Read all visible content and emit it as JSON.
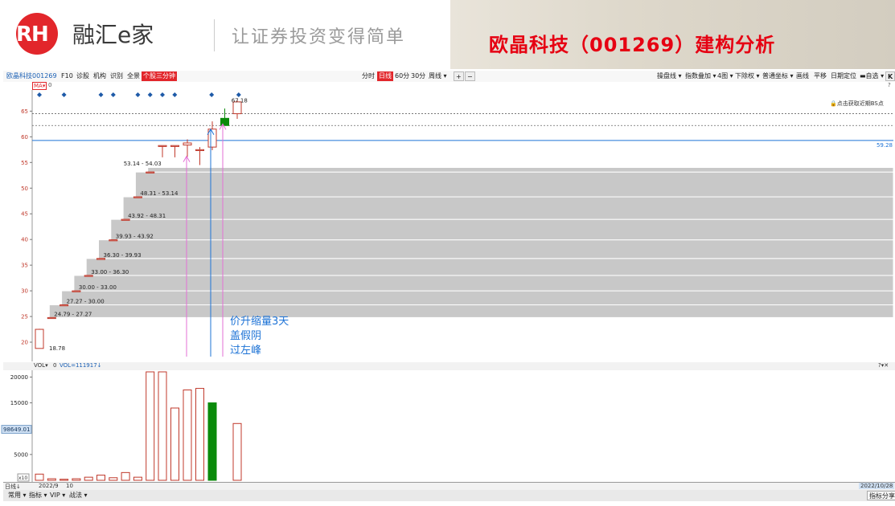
{
  "header": {
    "logo_mark": "RH",
    "logo_name": "融汇e家",
    "slogan": "让证券投资变得简单",
    "title": "欧晶科技（001269）建构分析"
  },
  "toolbar": {
    "stock_name": "欧晶科技",
    "stock_code": "001269",
    "left_items": [
      "F10",
      "诊股",
      "机构",
      "识别",
      "全景"
    ],
    "active_item": "个股三分钟",
    "period_items": [
      "分时",
      "日线",
      "60分",
      "30分",
      "周线 ▾"
    ],
    "active_period": "日线",
    "zoom_in": "+",
    "zoom_out": "−",
    "right_items": [
      "操盘线 ▾",
      "指数叠加 ▾",
      "4图 ▾",
      "下除权 ▾",
      "普通坐标 ▾",
      "画线",
      "平移",
      "日期定位",
      "▬自选 ▾"
    ],
    "help": "?"
  },
  "indicator": {
    "ma_label": "MA▾",
    "ma_value": "0"
  },
  "bs_hint": "点击获取近期BS点",
  "price_line_label": "59.28",
  "price_axis": [
    "65",
    "60",
    "55",
    "50",
    "45",
    "40",
    "35",
    "30",
    "25",
    "20"
  ],
  "step_labels": [
    "24.79 - 27.27",
    "27.27 - 30.00",
    "30.00 - 33.00",
    "33.00 - 36.30",
    "36.30 - 39.93",
    "39.93 - 43.92",
    "43.92 - 48.31",
    "48.31 - 53.14",
    "53.14 - 54.03"
  ],
  "low_label": "18.78",
  "high_label": "67.18",
  "annotation": [
    "价升缩量3天",
    "盖假阴",
    "过左峰"
  ],
  "volume": {
    "head_label": "VOL▾",
    "head_value": "0",
    "head_detail": "VOL=111917↓",
    "axis": [
      "20000",
      "15000",
      "5000"
    ],
    "current_readout": "98649.01",
    "unit": "x10"
  },
  "axis": {
    "left": "日线↓",
    "date1": "2022/9",
    "date2": "10",
    "date_right": "2022/10/28"
  },
  "bottom": {
    "items": [
      "常用 ▾",
      "指标 ▾",
      "VIP ▾",
      "战法 ▾"
    ],
    "share": "指标分享"
  },
  "colors": {
    "accent_red": "#e60012",
    "up": "#c0392b",
    "down": "#0a8a0a",
    "step_fill": "#c8c8c8",
    "price_line": "#1e73d6",
    "arrow_pink": "#e36fd6",
    "arrow_blue": "#1e73d6"
  },
  "chart_data": {
    "type": "candlestick",
    "ylim": [
      17.5,
      68.5
    ],
    "candles": [
      {
        "open": 18.78,
        "close": 22.5,
        "high": 22.6,
        "low": 18.78,
        "dir": "up"
      },
      {
        "open": 24.79,
        "close": 24.79,
        "high": 24.79,
        "low": 24.79,
        "dir": "up"
      },
      {
        "open": 27.27,
        "close": 27.27,
        "high": 27.27,
        "low": 27.27,
        "dir": "up"
      },
      {
        "open": 30.0,
        "close": 30.0,
        "high": 30.0,
        "low": 30.0,
        "dir": "up"
      },
      {
        "open": 33.0,
        "close": 33.0,
        "high": 33.0,
        "low": 33.0,
        "dir": "up"
      },
      {
        "open": 36.3,
        "close": 36.3,
        "high": 36.3,
        "low": 36.3,
        "dir": "up"
      },
      {
        "open": 39.93,
        "close": 39.93,
        "high": 39.93,
        "low": 39.93,
        "dir": "up"
      },
      {
        "open": 43.92,
        "close": 43.92,
        "high": 43.92,
        "low": 43.92,
        "dir": "up"
      },
      {
        "open": 48.31,
        "close": 48.31,
        "high": 48.31,
        "low": 48.31,
        "dir": "up"
      },
      {
        "open": 53.14,
        "close": 53.14,
        "high": 53.14,
        "low": 53.14,
        "dir": "up"
      },
      {
        "open": 58.3,
        "close": 58.3,
        "high": 58.3,
        "low": 56.0,
        "dir": "up"
      },
      {
        "open": 58.3,
        "close": 58.3,
        "high": 58.3,
        "low": 56.0,
        "dir": "up"
      },
      {
        "open": 58.8,
        "close": 58.4,
        "high": 59.5,
        "low": 56.1,
        "dir": "up"
      },
      {
        "open": 57.5,
        "close": 57.5,
        "high": 58.0,
        "low": 54.5,
        "dir": "up"
      },
      {
        "open": 58.0,
        "close": 61.5,
        "high": 63.0,
        "low": 57.4,
        "dir": "up"
      },
      {
        "open": 63.6,
        "close": 62.2,
        "high": 65.5,
        "low": 62.2,
        "dir": "down"
      },
      {
        "open": 64.5,
        "close": 66.8,
        "high": 67.18,
        "low": 63.5,
        "dir": "up"
      }
    ],
    "steps": [
      [
        24.79,
        27.27
      ],
      [
        27.27,
        30.0
      ],
      [
        30.0,
        33.0
      ],
      [
        33.0,
        36.3
      ],
      [
        36.3,
        39.93
      ],
      [
        39.93,
        43.92
      ],
      [
        43.92,
        48.31
      ],
      [
        48.31,
        53.14
      ],
      [
        53.14,
        54.03
      ]
    ],
    "price_line": 59.28,
    "dashed_levels": [
      62.2,
      64.5
    ],
    "volume_ylim": [
      0,
      21000
    ],
    "volumes": [
      1200,
      300,
      200,
      300,
      600,
      1000,
      500,
      1500,
      600,
      21000,
      21000,
      14000,
      17500,
      17800,
      15000,
      0,
      11000
    ],
    "volume_dirs": [
      "up",
      "up",
      "up",
      "up",
      "up",
      "up",
      "up",
      "up",
      "up",
      "up",
      "up",
      "up",
      "up",
      "up",
      "down",
      "up",
      "up"
    ]
  }
}
